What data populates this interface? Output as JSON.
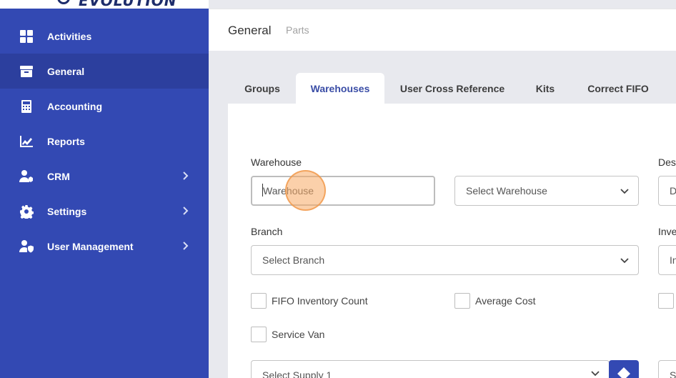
{
  "sidebar": {
    "logo_text": "EVOLUTION",
    "items": [
      {
        "label": "Activities",
        "icon": "grid-icon",
        "active": false,
        "has_chevron": false
      },
      {
        "label": "General",
        "icon": "archive-icon",
        "active": true,
        "has_chevron": false
      },
      {
        "label": "Accounting",
        "icon": "calculator-icon",
        "active": false,
        "has_chevron": false
      },
      {
        "label": "Reports",
        "icon": "chart-icon",
        "active": false,
        "has_chevron": false
      },
      {
        "label": "CRM",
        "icon": "users-icon",
        "active": false,
        "has_chevron": true
      },
      {
        "label": "Settings",
        "icon": "gear-icon",
        "active": false,
        "has_chevron": true
      },
      {
        "label": "User Management",
        "icon": "user-shield-icon",
        "active": false,
        "has_chevron": true
      }
    ]
  },
  "header": {
    "title": "General",
    "subtitle": "Parts"
  },
  "tabs": [
    {
      "label": "Groups",
      "active": false
    },
    {
      "label": "Warehouses",
      "active": true
    },
    {
      "label": "User Cross Reference",
      "active": false
    },
    {
      "label": "Kits",
      "active": false
    },
    {
      "label": "Correct FIFO",
      "active": false
    }
  ],
  "form": {
    "warehouse_label": "Warehouse",
    "warehouse_value": "Warehouse",
    "select_warehouse": "Select Warehouse",
    "description_label": "Des",
    "description_value": "D",
    "branch_label": "Branch",
    "select_branch": "Select Branch",
    "inventory_label": "Inve",
    "inventory_value": "In",
    "fifo_label": "FIFO Inventory Count",
    "average_cost_label": "Average Cost",
    "service_van_label": "Service Van",
    "select_supply": "Select Supply 1",
    "right_cut_value": "S"
  },
  "colors": {
    "sidebar_bg": "#3349b3",
    "sidebar_active": "#2c3f9e",
    "accent_text": "#3a4da6",
    "click_marker": "#f7aa64"
  }
}
